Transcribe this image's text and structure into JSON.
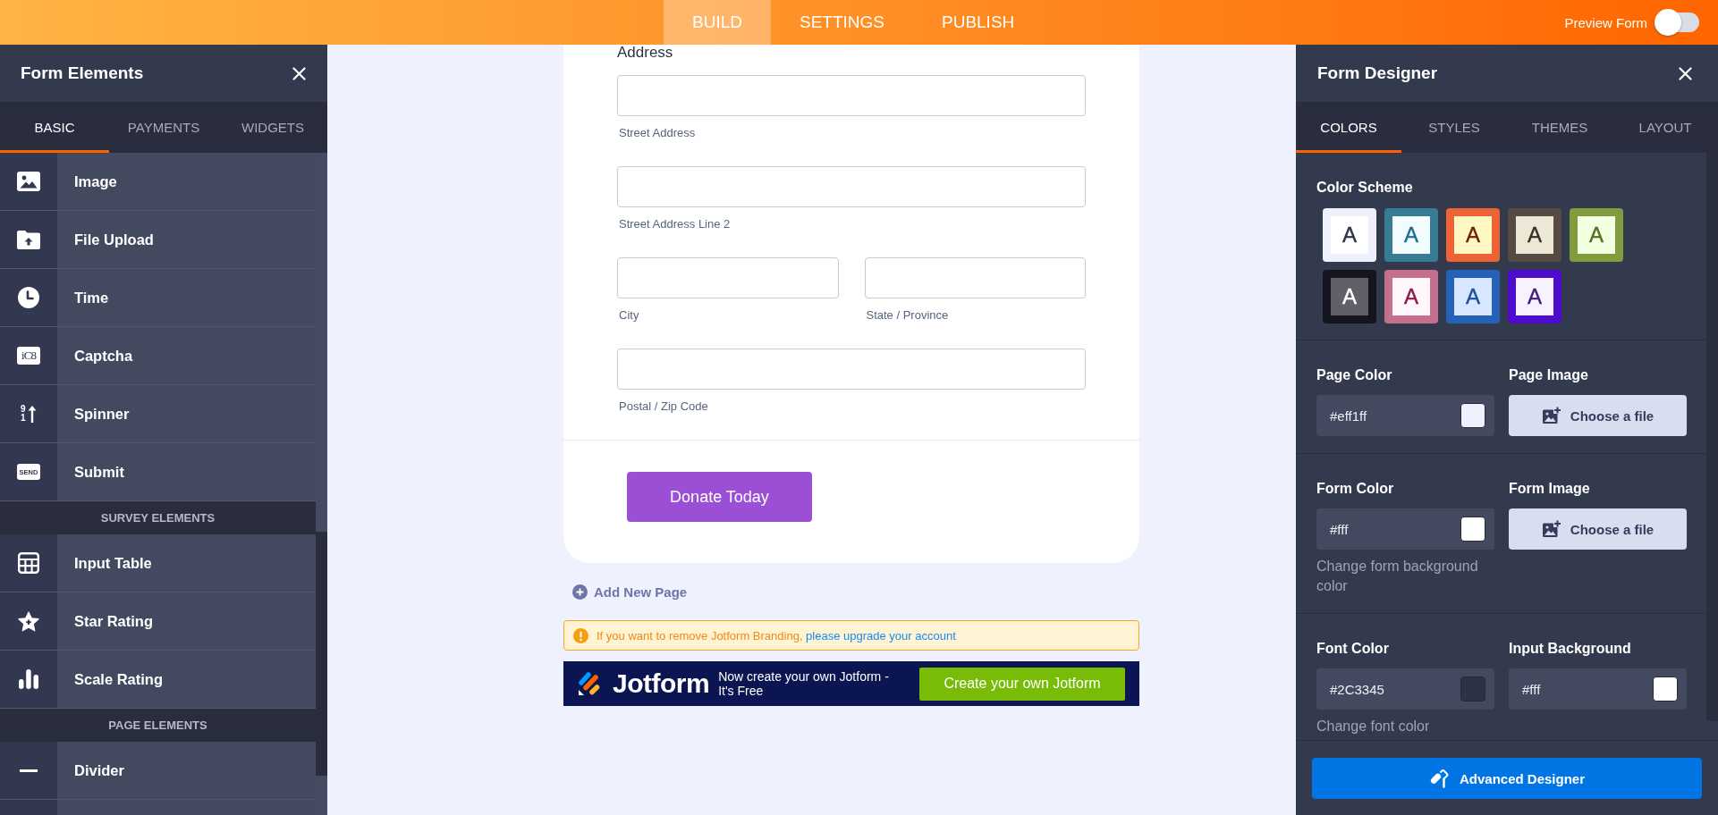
{
  "topbar": {
    "nav": [
      {
        "label": "BUILD",
        "selected": true
      },
      {
        "label": "SETTINGS",
        "selected": false
      },
      {
        "label": "PUBLISH",
        "selected": false
      }
    ],
    "preview": {
      "label": "Preview Form",
      "on": false
    }
  },
  "form_elements": {
    "title": "Form Elements",
    "tabs": [
      {
        "label": "BASIC",
        "selected": true
      },
      {
        "label": "PAYMENTS",
        "selected": false
      },
      {
        "label": "WIDGETS",
        "selected": false
      }
    ],
    "groups": [
      {
        "items": [
          {
            "label": "Image"
          },
          {
            "label": "File Upload"
          },
          {
            "label": "Time"
          },
          {
            "label": "Captcha",
            "icon_text": "iC8"
          },
          {
            "label": "Spinner",
            "icon_text": "91"
          },
          {
            "label": "Submit",
            "icon_text": "SEND"
          }
        ]
      },
      {
        "heading": "SURVEY ELEMENTS",
        "items": [
          {
            "label": "Input Table"
          },
          {
            "label": "Star Rating"
          },
          {
            "label": "Scale Rating"
          }
        ]
      },
      {
        "heading": "PAGE ELEMENTS",
        "items": [
          {
            "label": "Divider"
          }
        ]
      }
    ]
  },
  "form": {
    "address": {
      "label": "Address",
      "fields": [
        {
          "sublabel": "Street Address",
          "half": false
        },
        {
          "sublabel": "Street Address Line 2",
          "half": false
        },
        {
          "sublabel": "City",
          "half": true
        },
        {
          "sublabel": "State / Province",
          "half": true
        },
        {
          "sublabel": "Postal / Zip Code",
          "half": false
        }
      ]
    },
    "submit_button": "Donate Today"
  },
  "add_page": "Add New Page",
  "branding_notice": {
    "text": "If you want to remove Jotform Branding,",
    "link": "please upgrade your account"
  },
  "banner": {
    "logo": "Jotform",
    "tagline": "Now create your own Jotform - It's Free",
    "button": "Create your own Jotform"
  },
  "form_designer": {
    "title": "Form Designer",
    "tabs": [
      {
        "label": "COLORS",
        "selected": true
      },
      {
        "label": "STYLES",
        "selected": false
      },
      {
        "label": "THEMES",
        "selected": false
      },
      {
        "label": "LAYOUT",
        "selected": false
      }
    ],
    "color_scheme": {
      "title": "Color Scheme",
      "swatches": [
        {
          "color": "#eef1fb",
          "tile": {
            "color": "#ffffff"
          },
          "letter": {
            "text": "A",
            "color": "#2c3345"
          }
        },
        {
          "color": "#377c94",
          "tile": {
            "color": "#f2fcff"
          },
          "letter": {
            "text": "A",
            "color": "#1c6e8c"
          }
        },
        {
          "color": "#ef6236",
          "tile": {
            "color": "#fff8c2"
          },
          "letter": {
            "text": "A",
            "color": "#6d1e05"
          }
        },
        {
          "color": "#574a43",
          "tile": {
            "color": "#ede7d6"
          },
          "letter": {
            "text": "A",
            "color": "#3c2d25"
          }
        },
        {
          "color": "#7f9d3c",
          "tile": {
            "color": "#f2ffe0"
          },
          "letter": {
            "text": "A",
            "color": "#5b6b23"
          }
        },
        {
          "color": "#14151f",
          "tile": {
            "color": "#5f6068"
          },
          "letter": {
            "text": "A",
            "color": "#ffffff"
          }
        },
        {
          "color": "#c4708d",
          "tile": {
            "color": "#fff7fb"
          },
          "letter": {
            "text": "A",
            "color": "#8c1a47"
          }
        },
        {
          "color": "#2661b8",
          "tile": {
            "color": "#d8e7ff"
          },
          "letter": {
            "text": "A",
            "color": "#1d4c9c"
          }
        },
        {
          "color": "#4e0ccc",
          "tile": {
            "color": "#f6f2ff"
          },
          "letter": {
            "text": "A",
            "color": "#3f1a7a"
          }
        }
      ]
    },
    "sections": [
      {
        "controls": [
          {
            "kind": "color",
            "label": "Page Color",
            "value": "#eff1ff",
            "color": "#eff1ff"
          },
          {
            "kind": "file",
            "label": "Page Image",
            "button": "Choose a file"
          }
        ]
      },
      {
        "controls": [
          {
            "kind": "color",
            "label": "Form Color",
            "value": "#fff",
            "color": "#ffffff",
            "help": "Change form background color"
          },
          {
            "kind": "file",
            "label": "Form Image",
            "button": "Choose a file"
          }
        ]
      },
      {
        "controls": [
          {
            "kind": "color",
            "label": "Font Color",
            "value": "#2C3345",
            "color": "#2c3345",
            "help": "Change font color"
          },
          {
            "kind": "color",
            "label": "Input Background",
            "value": "#fff",
            "color": "#ffffff"
          }
        ]
      }
    ],
    "advanced_button": "Advanced Designer"
  }
}
